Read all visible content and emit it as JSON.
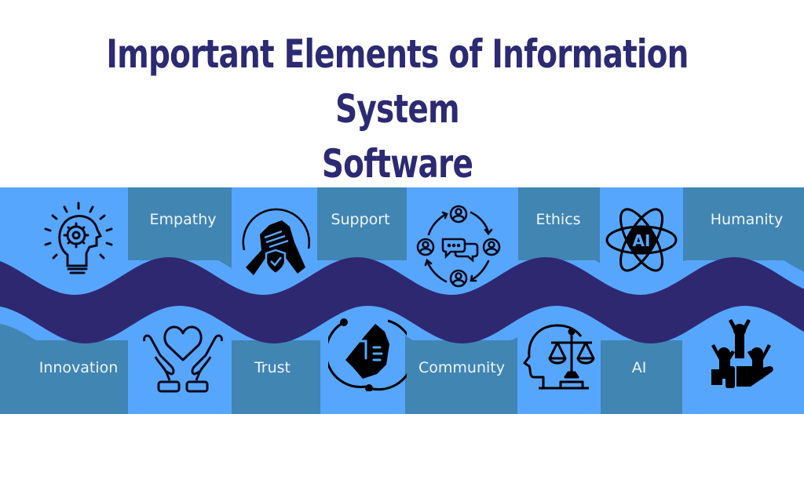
{
  "title_line1": "Important Elements of Information System",
  "title_line2": "Software",
  "colors": {
    "title": "#2c2a72",
    "light_blue": "#57a6fe",
    "dark_blue": "#4185b3",
    "wave": "#2e2870",
    "label_text": "#eef6fb"
  },
  "top_row": [
    {
      "type": "icon",
      "icon": "lightbulb-gear-head-icon"
    },
    {
      "type": "label",
      "label": "Empathy"
    },
    {
      "type": "icon",
      "icon": "joined-hands-shield-icon"
    },
    {
      "type": "label",
      "label": "Support"
    },
    {
      "type": "icon",
      "icon": "community-chat-cycle-icon"
    },
    {
      "type": "label",
      "label": "Ethics"
    },
    {
      "type": "icon",
      "icon": "ai-atom-icon"
    },
    {
      "type": "label",
      "label": "Humanity"
    }
  ],
  "bottom_row": [
    {
      "type": "label",
      "label": "Innovation"
    },
    {
      "type": "icon",
      "icon": "hands-heart-icon"
    },
    {
      "type": "label",
      "label": "Trust"
    },
    {
      "type": "icon",
      "icon": "helping-hand-circle-icon"
    },
    {
      "type": "label",
      "label": "Community"
    },
    {
      "type": "icon",
      "icon": "head-justice-scale-icon"
    },
    {
      "type": "label",
      "label": "AI"
    },
    {
      "type": "icon",
      "icon": "group-cheering-hand-icon"
    }
  ],
  "ai_badge_text": "AI"
}
